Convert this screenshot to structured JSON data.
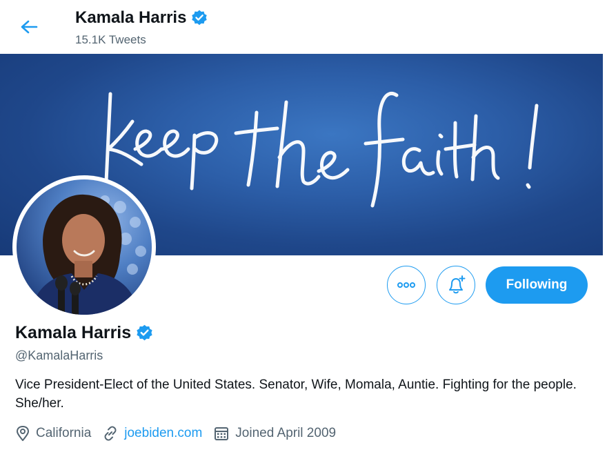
{
  "header": {
    "name": "Kamala Harris",
    "tweet_count": "15.1K Tweets"
  },
  "banner": {
    "script_text": "Keep the faith!"
  },
  "actions": {
    "following_label": "Following"
  },
  "profile": {
    "name": "Kamala Harris",
    "handle": "@KamalaHarris",
    "bio": "Vice President-Elect of the United States. Senator, Wife, Momala, Auntie. Fighting for the people. She/her.",
    "location": "California",
    "website": "joebiden.com",
    "joined": "Joined April 2009"
  },
  "icons": [
    "back-arrow-icon",
    "verified-badge-icon",
    "more-options-icon",
    "bell-plus-icon",
    "location-pin-icon",
    "link-icon",
    "calendar-icon"
  ],
  "colors": {
    "accent": "#1d9bf0",
    "banner": "#2c5ea8",
    "secondary_text": "#536471"
  }
}
